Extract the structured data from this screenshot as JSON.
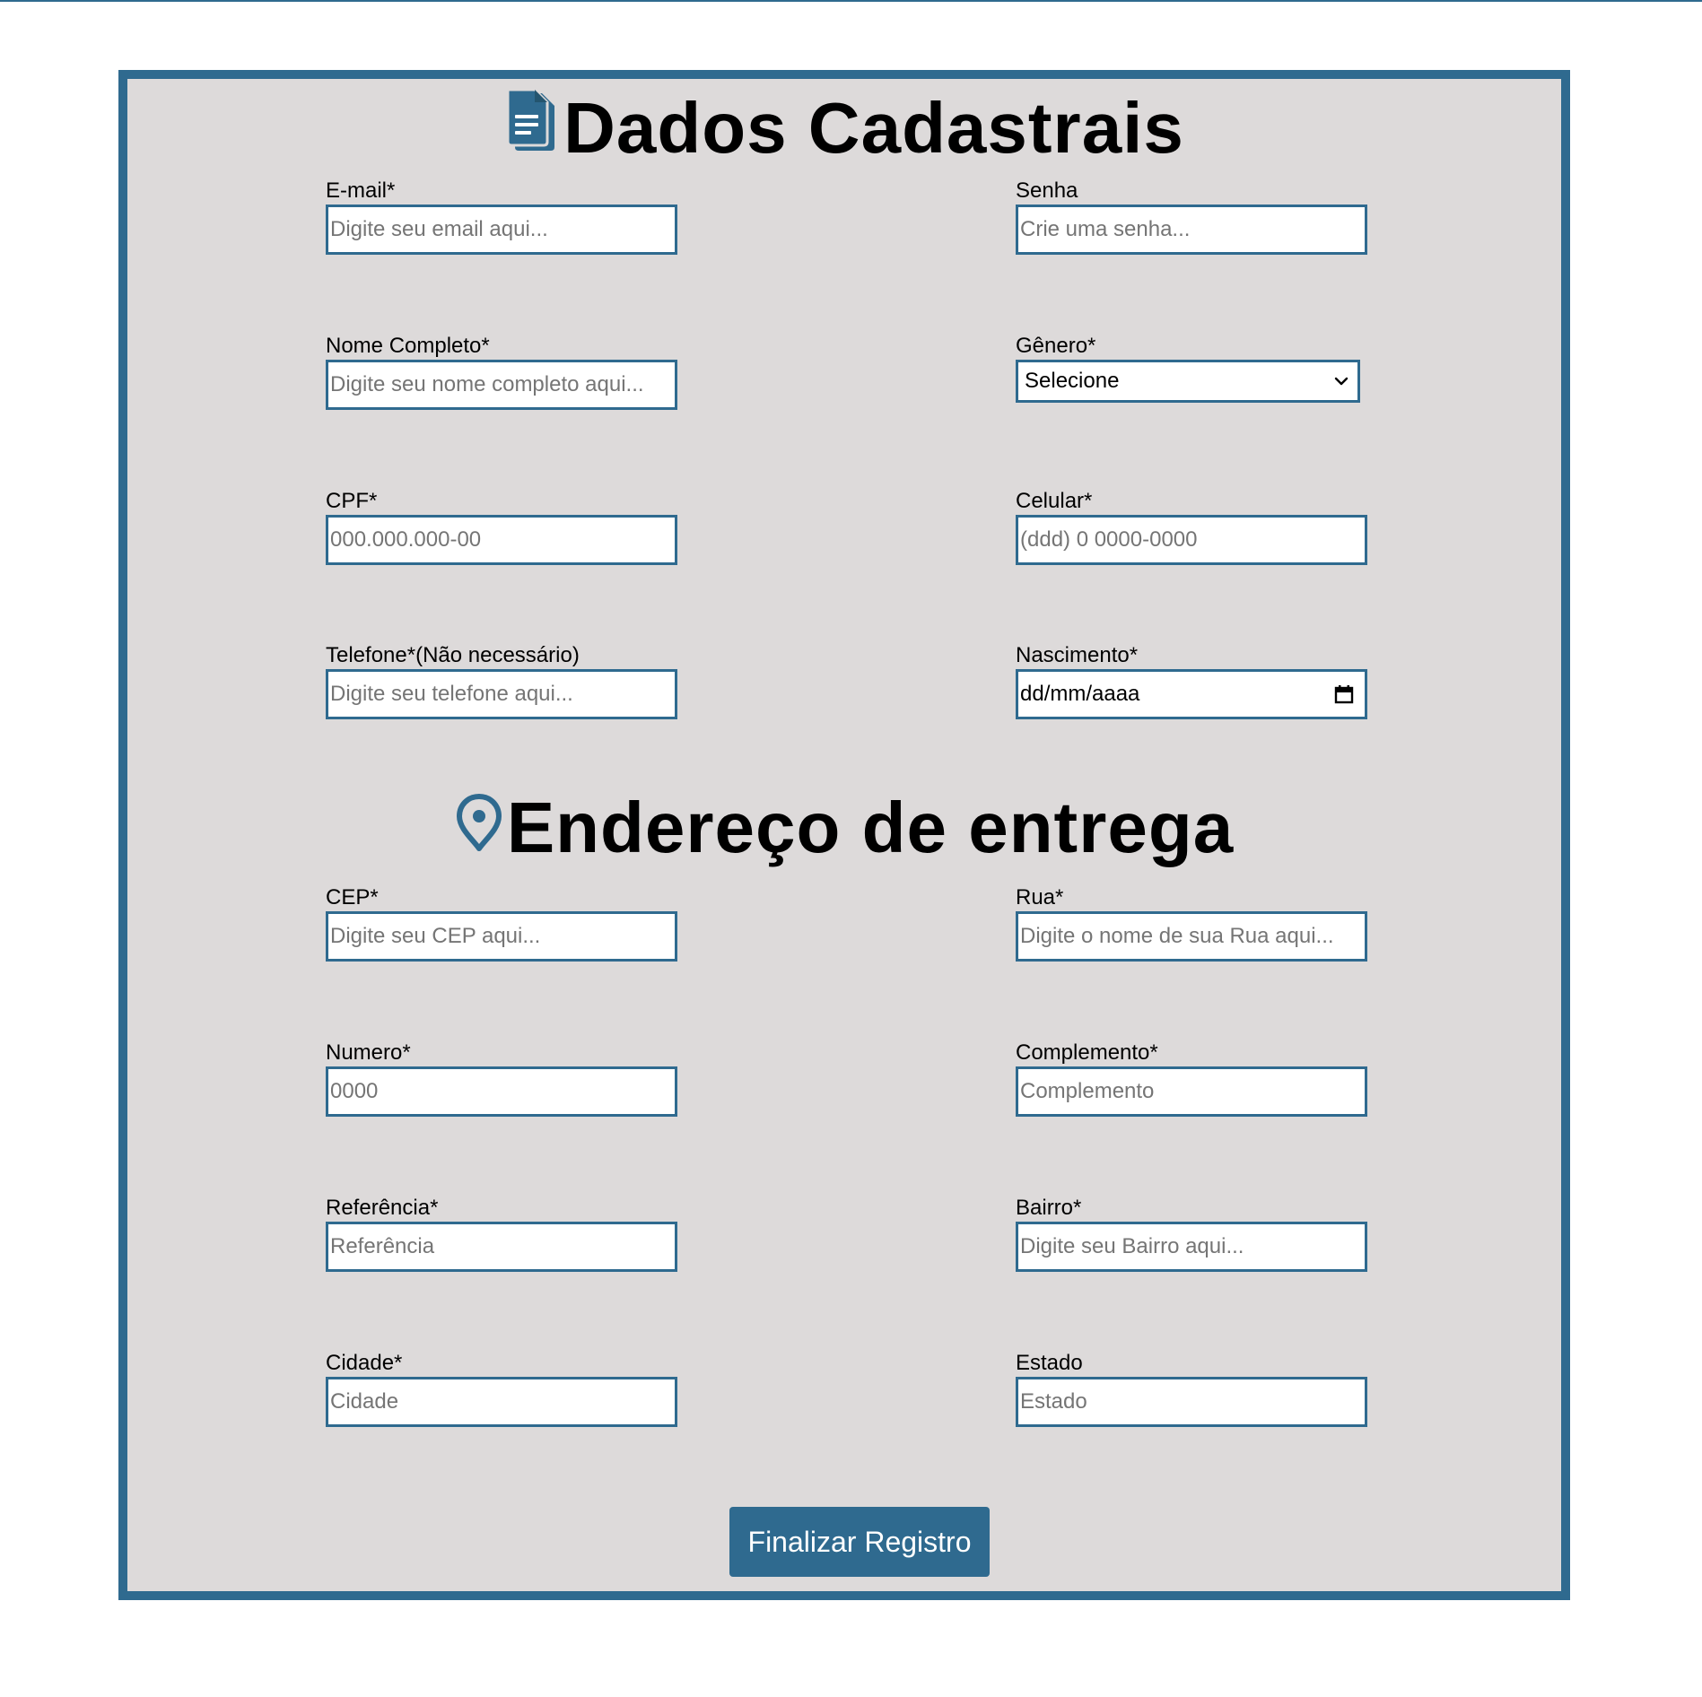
{
  "colors": {
    "accent": "#2f6a8f",
    "panel_background": "#dddada",
    "input_background": "#ffffff"
  },
  "section_personal": {
    "icon": "document-icon",
    "title": "Dados Cadastrais",
    "fields": {
      "email": {
        "label": "E-mail*",
        "placeholder": "Digite seu email aqui..."
      },
      "senha": {
        "label": "Senha",
        "placeholder": "Crie uma senha..."
      },
      "nome": {
        "label": "Nome Completo*",
        "placeholder": "Digite seu nome completo aqui..."
      },
      "genero": {
        "label": "Gênero*",
        "selected": "Selecione"
      },
      "cpf": {
        "label": "CPF*",
        "placeholder": "000.000.000-00"
      },
      "celular": {
        "label": "Celular*",
        "placeholder": "(ddd) 0 0000-0000"
      },
      "telefone": {
        "label": "Telefone*(Não necessário)",
        "placeholder": "Digite seu telefone aqui..."
      },
      "nascimento": {
        "label": "Nascimento*",
        "value": "dd/mm/aaaa"
      }
    }
  },
  "section_address": {
    "icon": "location-pin-icon",
    "title": "Endereço de entrega",
    "fields": {
      "cep": {
        "label": "CEP*",
        "placeholder": "Digite seu CEP aqui..."
      },
      "rua": {
        "label": "Rua*",
        "placeholder": "Digite o nome de sua Rua aqui..."
      },
      "numero": {
        "label": "Numero*",
        "placeholder": "0000"
      },
      "complemento": {
        "label": "Complemento*",
        "placeholder": "Complemento"
      },
      "referencia": {
        "label": "Referência*",
        "placeholder": "Referência"
      },
      "bairro": {
        "label": "Bairro*",
        "placeholder": "Digite seu Bairro aqui..."
      },
      "cidade": {
        "label": "Cidade*",
        "placeholder": "Cidade"
      },
      "estado": {
        "label": "Estado",
        "placeholder": "Estado"
      }
    }
  },
  "submit": {
    "label": "Finalizar Registro"
  }
}
